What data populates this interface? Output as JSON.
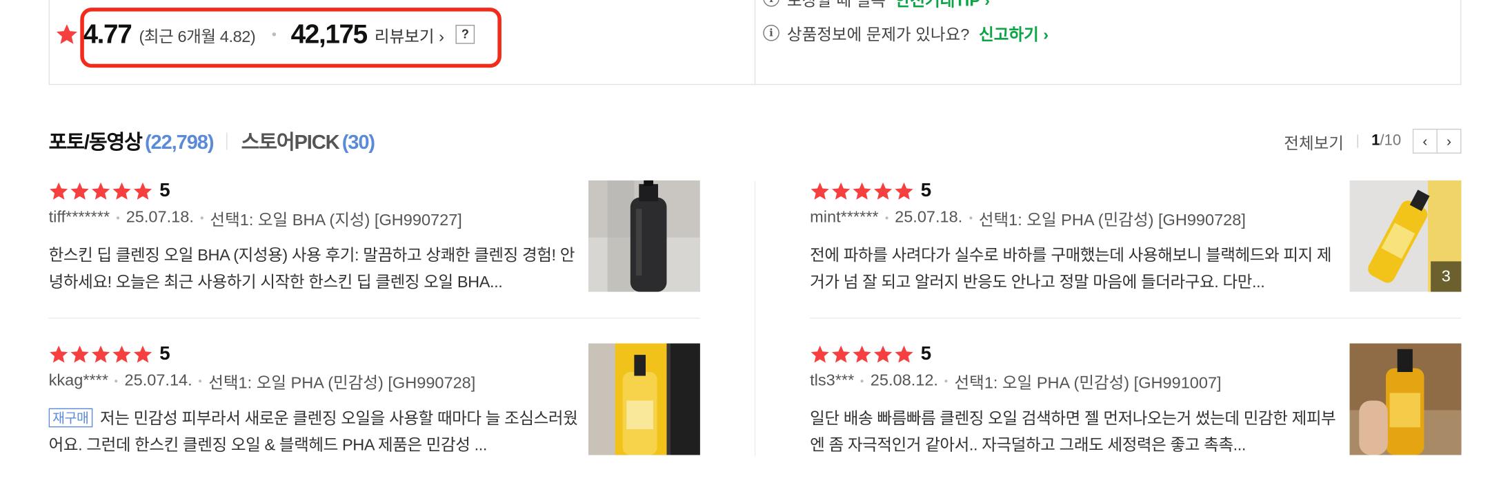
{
  "summary": {
    "average": "4.77",
    "recent": "(최근 6개월 4.82)",
    "review_count": "42,175",
    "review_link": "리뷰보기 ›",
    "help": "?"
  },
  "info": {
    "line1_text": "포장할 때 필독",
    "line1_link": "안전거래TIP ›",
    "line2_text": "상품정보에 문제가 있나요?",
    "line2_link": "신고하기 ›",
    "icon": "ℹ"
  },
  "tabs": [
    {
      "label": "포토/동영상",
      "count": "(22,798)"
    },
    {
      "label": "스토어PICK",
      "count": "(30)"
    }
  ],
  "pager": {
    "see_all": "전체보기",
    "current": "1",
    "total": "/10",
    "prev": "‹",
    "next": "›"
  },
  "reviews": [
    {
      "rating": 5,
      "score": "5",
      "user": "tiff*******",
      "date": "25.07.18.",
      "option": "선택1: 오일 BHA (지성) [GH990727]",
      "badge": "",
      "text": "한스킨 딥 클렌징 오일 BHA (지성용) 사용 후기: 말끔하고 상쾌한 클렌징 경험! 안녕하세요! 오늘은 최근 사용하기 시작한 한스킨 딥 클렌징 오일 BHA...",
      "image_count": ""
    },
    {
      "rating": 5,
      "score": "5",
      "user": "mint******",
      "date": "25.07.18.",
      "option": "선택1: 오일 PHA (민감성) [GH990728]",
      "badge": "",
      "text": "전에 파하를 사려다가 실수로 바하를 구매했는데 사용해보니 블랙헤드와 피지 제거가 넘 잘 되고 알러지 반응도 안나고 정말 마음에 들더라구요. 다만...",
      "image_count": "3"
    },
    {
      "rating": 5,
      "score": "5",
      "user": "kkag****",
      "date": "25.07.14.",
      "option": "선택1: 오일 PHA (민감성) [GH990728]",
      "badge": "재구매",
      "text": "저는 민감성 피부라서 새로운 클렌징 오일을 사용할 때마다 늘 조심스러웠어요. 그런데 한스킨 클렌징 오일 & 블랙헤드 PHA 제품은 민감성 ...",
      "image_count": ""
    },
    {
      "rating": 5,
      "score": "5",
      "user": "tls3***",
      "date": "25.08.12.",
      "option": "선택1: 오일 PHA (민감성) [GH991007]",
      "badge": "",
      "text": "일단 배송 빠름빠름 클렌징 오일 검색하면 젤 먼저나오는거 썼는데 민감한 제피부엔 좀 자극적인거 같아서.. 자극덜하고 그래도 세정력은 좋고 촉촉...",
      "image_count": ""
    }
  ],
  "colors": {
    "star": "#f6403f",
    "highlight": "#f22b1b",
    "link_green": "#0aa545",
    "count_blue": "#5b8ad8"
  },
  "icons": [
    "star-icon",
    "info-icon",
    "chevron-left-icon",
    "chevron-right-icon"
  ]
}
